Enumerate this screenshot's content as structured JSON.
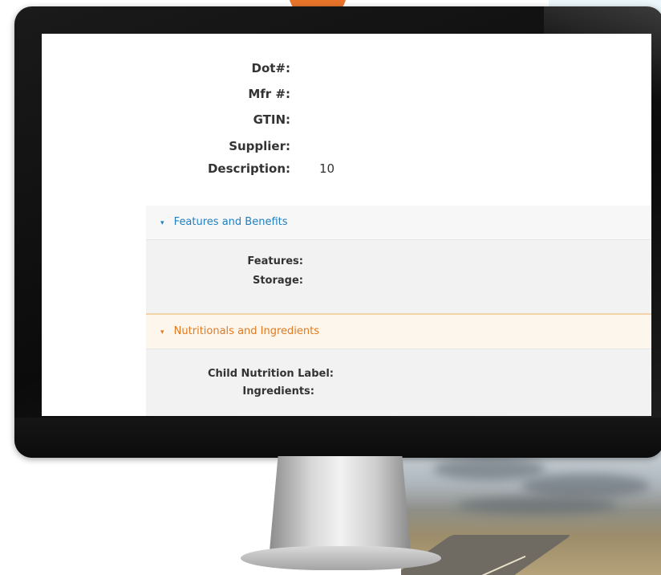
{
  "product_fields": [
    {
      "label": "Dot#:",
      "value": ""
    },
    {
      "label": "Mfr #:",
      "value": ""
    },
    {
      "label": "GTIN:",
      "value": ""
    },
    {
      "label": "Supplier:",
      "value": ""
    },
    {
      "label": "Description:",
      "value": "10"
    }
  ],
  "sections": [
    {
      "title": "Features and Benefits",
      "color": "#1f7fc0",
      "rows": [
        "Features:",
        "Storage:"
      ]
    },
    {
      "title": "Nutritionals and Ingredients",
      "color": "#e07a22",
      "rows": [
        "Child Nutrition Label:",
        "Ingredients:"
      ]
    }
  ]
}
